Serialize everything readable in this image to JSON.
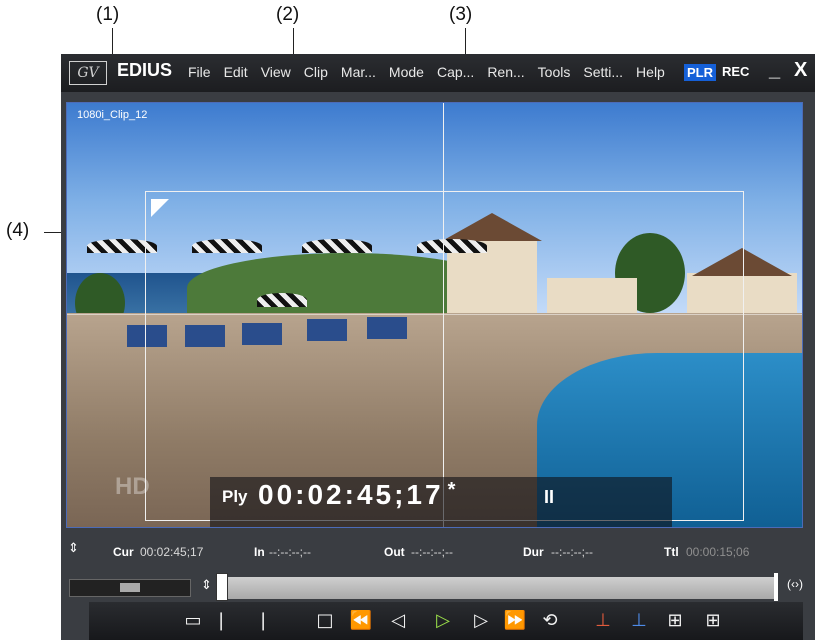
{
  "callouts": {
    "c1": "(1)",
    "c2": "(2)",
    "c3": "(3)",
    "c4": "(4)"
  },
  "titlebar": {
    "logo": "GV",
    "app_name": "EDIUS",
    "menu": [
      "File",
      "Edit",
      "View",
      "Clip",
      "Mar...",
      "Mode",
      "Cap...",
      "Ren...",
      "Tools",
      "Setti...",
      "Help"
    ],
    "plr": "PLR",
    "rec": "REC",
    "minimize": "_",
    "close": "X"
  },
  "video": {
    "clip_label": "1080i_Clip_12",
    "tc_mode": "Ply",
    "timecode": "00:02:45;17",
    "tc_flag": "*",
    "pause_symbol": "II",
    "watermark": "HD"
  },
  "info": {
    "cur_label": "Cur",
    "cur": "00:02:45;17",
    "in_label": "In",
    "in": "--:--:--;--",
    "out_label": "Out",
    "out": "--:--:--;--",
    "dur_label": "Dur",
    "dur": "--:--:--;--",
    "ttl_label": "Ttl",
    "ttl": "00:00:15;06"
  },
  "scrubber": {
    "playhead_position_fraction": 0.0
  },
  "transport": {
    "buttons": [
      {
        "name": "set-in-icon",
        "glyph": "▭"
      },
      {
        "name": "mark-in-icon",
        "glyph": "❘"
      },
      {
        "name": "mark-out-icon",
        "glyph": "❘"
      },
      {
        "name": "stop-icon",
        "glyph": "□"
      },
      {
        "name": "rewind-icon",
        "glyph": "⏪"
      },
      {
        "name": "step-back-icon",
        "glyph": "◁"
      },
      {
        "name": "play-icon",
        "glyph": "▷"
      },
      {
        "name": "step-forward-icon",
        "glyph": "▷"
      },
      {
        "name": "fast-forward-icon",
        "glyph": "⏩"
      },
      {
        "name": "loop-icon",
        "glyph": "⟲"
      },
      {
        "name": "insert-timeline-icon",
        "glyph": "⊥"
      },
      {
        "name": "overwrite-timeline-icon",
        "glyph": "⊥"
      },
      {
        "name": "add-bin-icon",
        "glyph": "⊞"
      },
      {
        "name": "add-sequence-icon",
        "glyph": "⊞"
      }
    ]
  },
  "colors": {
    "accent_blue": "#1560d8",
    "play_green": "#9be04a"
  }
}
